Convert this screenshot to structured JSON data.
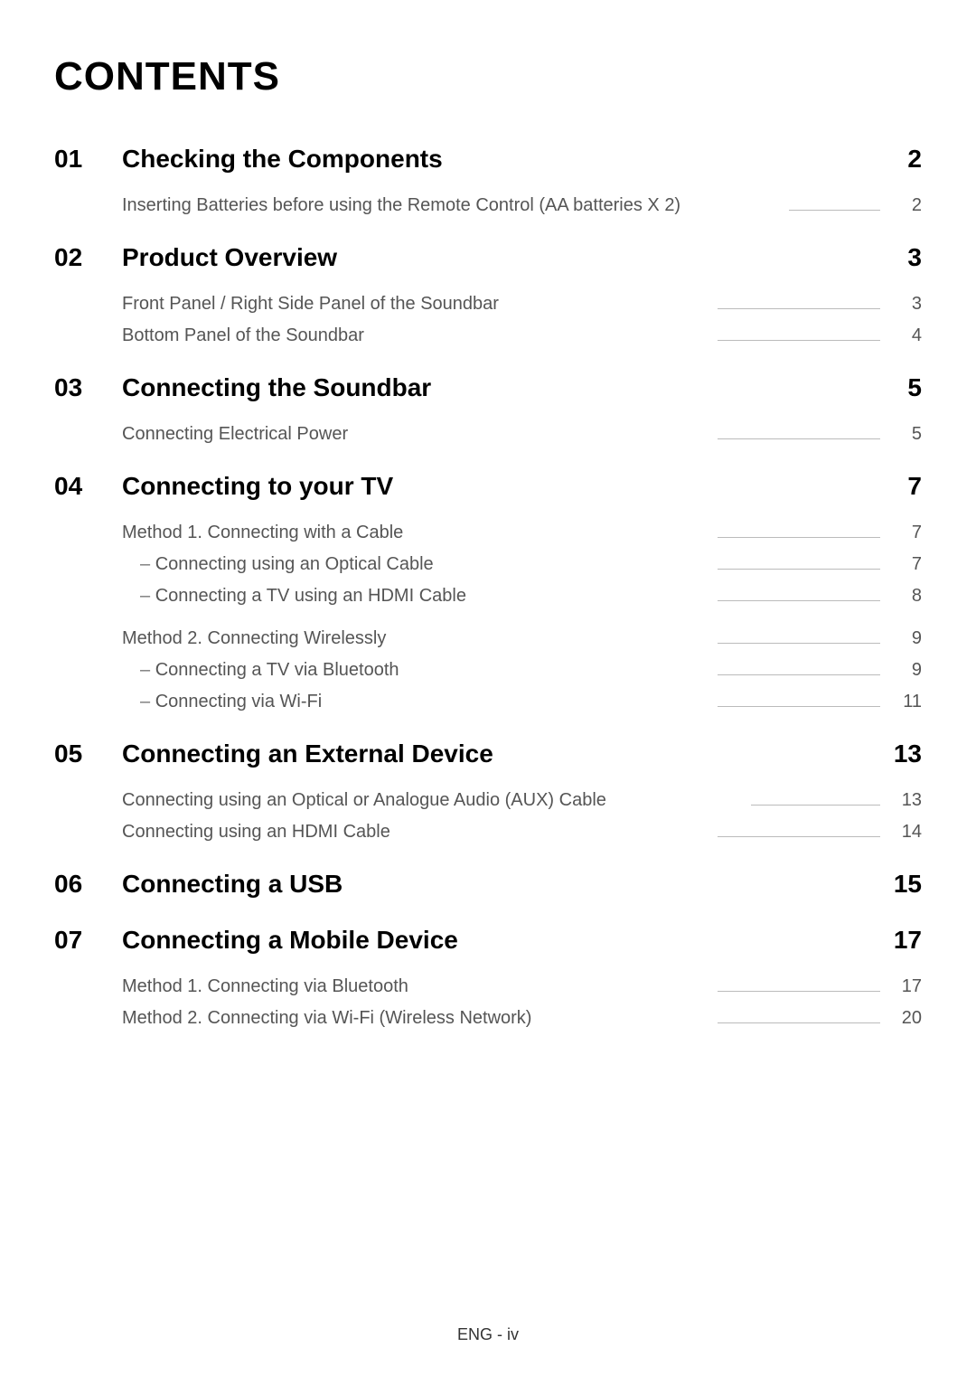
{
  "title": "CONTENTS",
  "footer": "ENG - iv",
  "sections": [
    {
      "num": "01",
      "title": "Checking the Components",
      "page": "2",
      "items": [
        {
          "label": "Inserting Batteries before using the Remote Control (AA batteries X 2)",
          "page": "2"
        }
      ]
    },
    {
      "num": "02",
      "title": "Product Overview",
      "page": "3",
      "items": [
        {
          "label": "Front Panel / Right Side Panel of the Soundbar",
          "page": "3"
        },
        {
          "label": "Bottom Panel of the Soundbar",
          "page": "4"
        }
      ]
    },
    {
      "num": "03",
      "title": "Connecting the Soundbar",
      "page": "5",
      "items": [
        {
          "label": "Connecting Electrical Power",
          "page": "5"
        }
      ]
    },
    {
      "num": "04",
      "title": "Connecting to your TV",
      "page": "7",
      "items": [
        {
          "label": "Method 1. Connecting with a Cable",
          "page": "7"
        },
        {
          "label": "Connecting using an Optical Cable",
          "page": "7",
          "sub": true
        },
        {
          "label": "Connecting a TV using an HDMI Cable",
          "page": "8",
          "sub": true
        },
        {
          "gap": true
        },
        {
          "label": "Method 2. Connecting Wirelessly",
          "page": "9"
        },
        {
          "label": "Connecting a TV via Bluetooth",
          "page": "9",
          "sub": true
        },
        {
          "label": "Connecting via Wi-Fi",
          "page": "11",
          "sub": true
        }
      ]
    },
    {
      "num": "05",
      "title": "Connecting an External Device",
      "page": "13",
      "items": [
        {
          "label": "Connecting using an Optical or Analogue Audio (AUX) Cable",
          "page": "13"
        },
        {
          "label": "Connecting using an HDMI Cable",
          "page": "14"
        }
      ]
    },
    {
      "num": "06",
      "title": "Connecting a USB",
      "page": "15",
      "items": []
    },
    {
      "num": "07",
      "title": "Connecting a Mobile Device",
      "page": "17",
      "items": [
        {
          "label": "Method 1. Connecting via Bluetooth",
          "page": "17"
        },
        {
          "label": "Method 2. Connecting via Wi-Fi (Wireless Network)",
          "page": "20"
        }
      ]
    }
  ]
}
